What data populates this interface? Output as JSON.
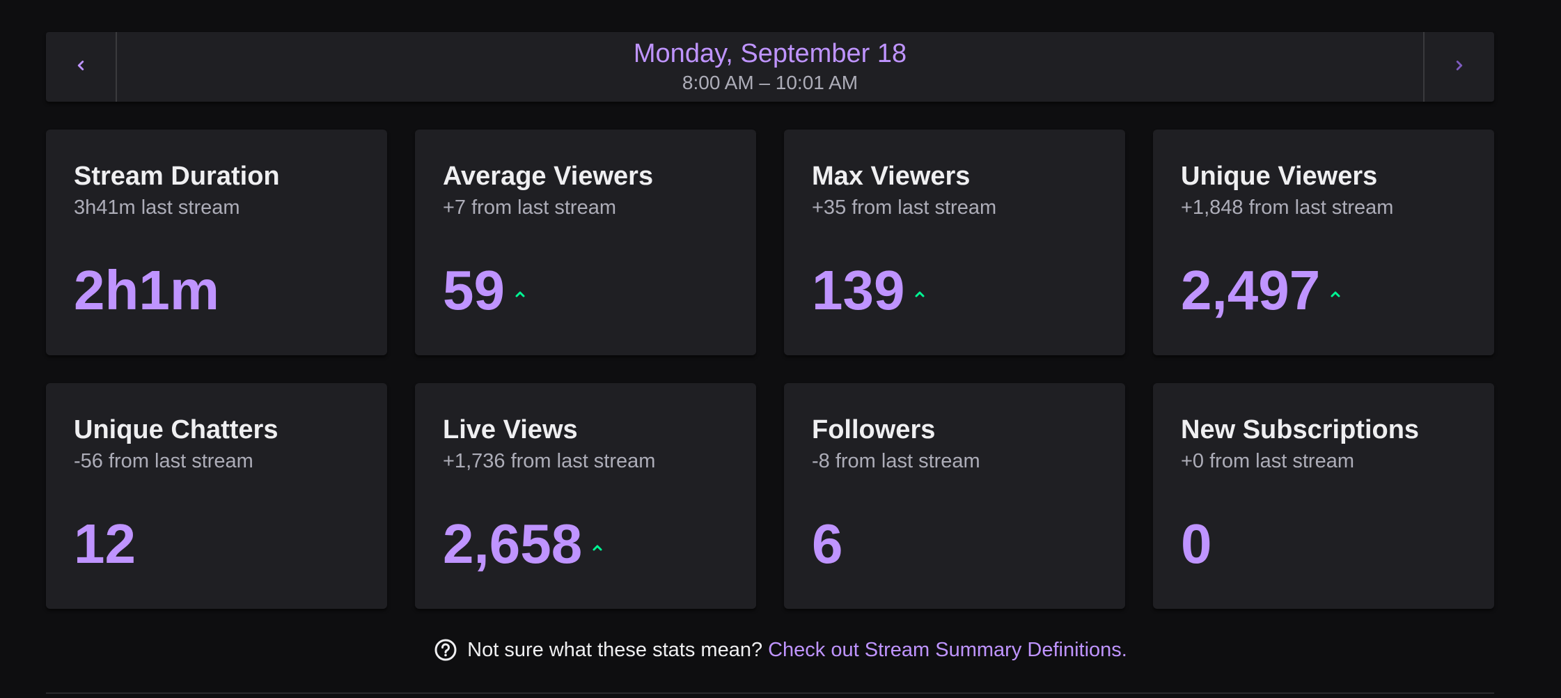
{
  "header": {
    "date": "Monday, September 18",
    "time_range": "8:00 AM – 10:01 AM",
    "prev_icon": "chevron-left-icon",
    "next_icon": "chevron-right-icon"
  },
  "stats": [
    {
      "title": "Stream Duration",
      "subtitle": "3h41m last stream",
      "value": "2h1m",
      "trend": "none"
    },
    {
      "title": "Average Viewers",
      "subtitle": "+7 from last stream",
      "value": "59",
      "trend": "up"
    },
    {
      "title": "Max Viewers",
      "subtitle": "+35 from last stream",
      "value": "139",
      "trend": "up"
    },
    {
      "title": "Unique Viewers",
      "subtitle": "+1,848 from last stream",
      "value": "2,497",
      "trend": "up"
    },
    {
      "title": "Unique Chatters",
      "subtitle": "-56 from last stream",
      "value": "12",
      "trend": "none"
    },
    {
      "title": "Live Views",
      "subtitle": "+1,736 from last stream",
      "value": "2,658",
      "trend": "up"
    },
    {
      "title": "Followers",
      "subtitle": "-8 from last stream",
      "value": "6",
      "trend": "none"
    },
    {
      "title": "New Subscriptions",
      "subtitle": "+0 from last stream",
      "value": "0",
      "trend": "none"
    }
  ],
  "help": {
    "icon": "question-circle-icon",
    "text": "Not sure what these stats mean?",
    "link": "Check out Stream Summary Definitions."
  },
  "colors": {
    "background": "#0e0e10",
    "card": "#1f1f23",
    "accent": "#bf94ff",
    "trend_up": "#00f593",
    "muted_text": "#adadb8"
  }
}
